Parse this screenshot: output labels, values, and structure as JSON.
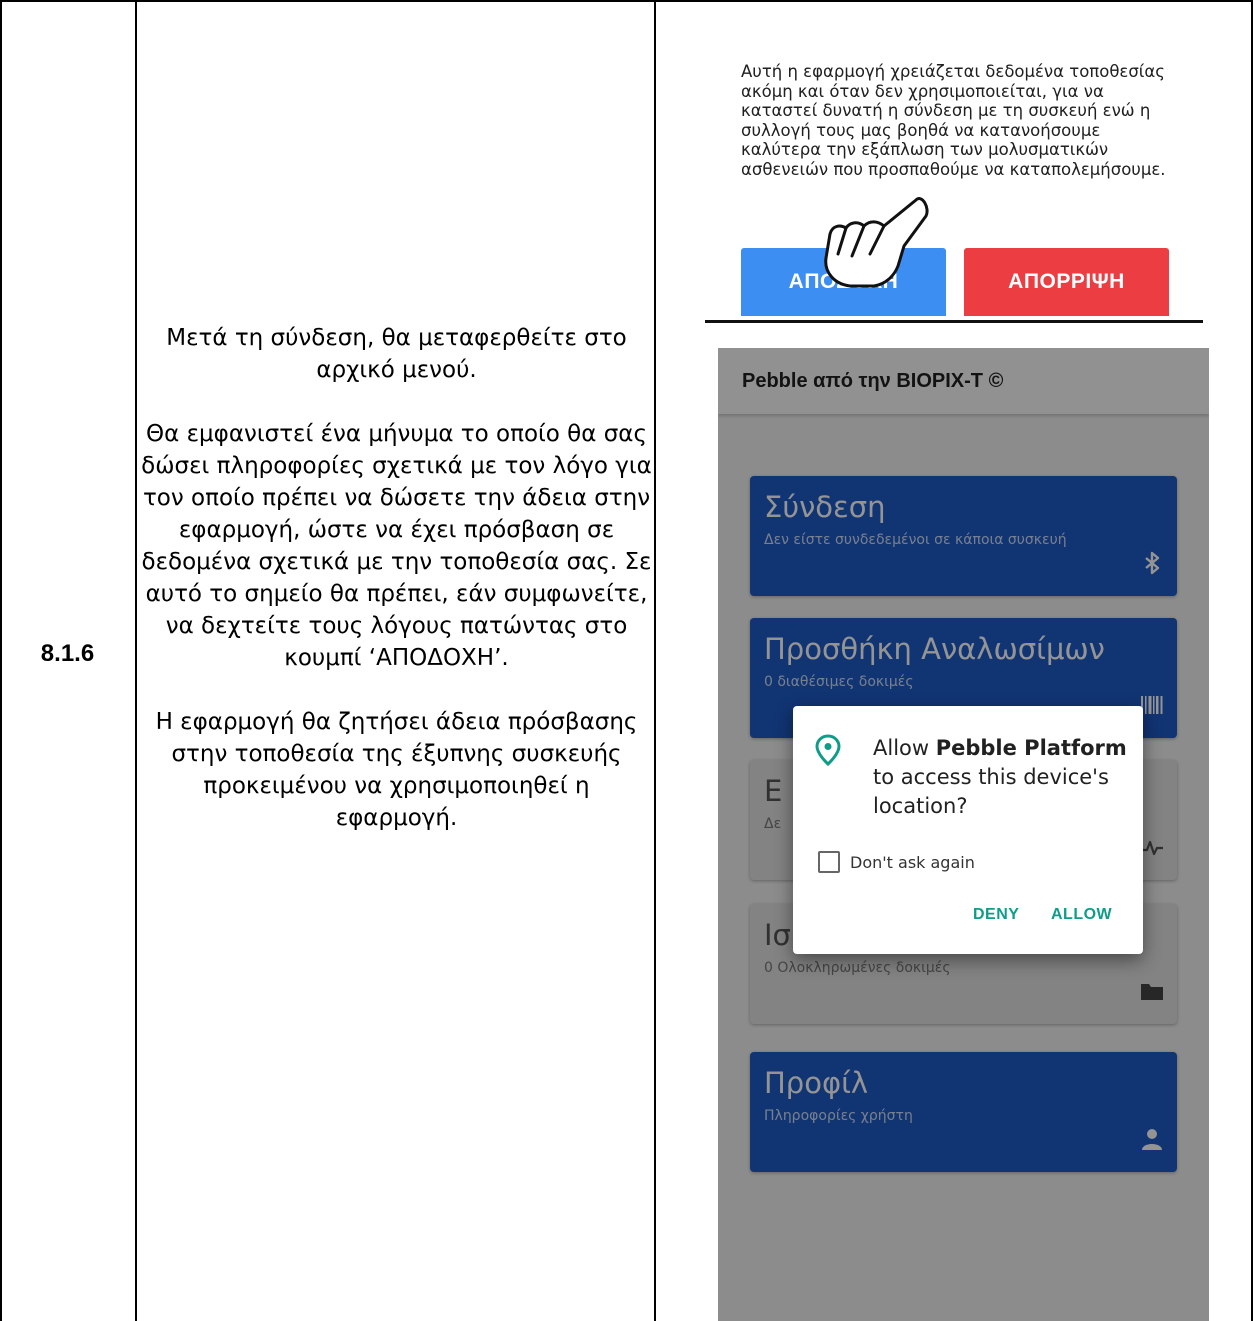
{
  "row": {
    "step_number": "8.1.6",
    "description": [
      "Μετά τη σύνδεση, θα μεταφερθείτε στο αρχικό μενού.",
      "Θα εμφανιστεί ένα μήνυμα το οποίο θα σας δώσει πληροφορίες σχετικά με τον λόγο για τον οποίο πρέπει να δώσετε την άδεια στην εφαρμογή, ώστε να έχει πρόσβαση σε δεδομένα σχετικά με την τοποθεσία σας. Σε αυτό το σημείο θα πρέπει, εάν συμφωνείτε, να δεχτείτε τους λόγους πατώντας στο κουμπί ‘ΑΠΟΔΟΧΗ’.",
      "Η εφαρμογή θα ζητήσει άδεια πρόσβασης στην τοποθεσία της έξυπνης συσκευής προκειμένου να χρησιμοποιηθεί η εφαρμογή."
    ]
  },
  "consent_screen": {
    "message": "Αυτή η εφαρμογή χρειάζεται δεδομένα τοποθεσίας ακόμη και όταν δεν χρησιμοποιείται, για να καταστεί δυνατή η σύνδεση με τη συσκευή ενώ η συλλογή τους μας βοηθά να κατανοήσουμε καλύτερα την εξάπλωση των μολυσματικών ασθενειών που προσπαθούμε να καταπολεμήσουμε.",
    "accept_label": "ΑΠΟΔΟΧΗ",
    "reject_label": "ΑΠΟΡΡΙΨΗ",
    "accept_color": "#3d8ef2",
    "reject_color": "#ec3d42"
  },
  "app": {
    "title": "Pebble από την BIOPIX-T ©",
    "cards": [
      {
        "title": "Σύνδεση",
        "subtitle": "Δεν είστε συνδεδεμένοι σε κάποια συσκευή",
        "icon": "bluetooth-icon"
      },
      {
        "title": "Προσθήκη Αναλωσίμων",
        "subtitle": "0 διαθέσιμες δοκιμές",
        "icon": "barcode-icon"
      },
      {
        "title": "Ε",
        "subtitle": "Δε",
        "icon": "chart-icon"
      },
      {
        "title": "Ισ",
        "subtitle": "0 Ολοκληρωμένες δοκιμές",
        "icon": "folder-icon"
      },
      {
        "title": "Προφίλ",
        "subtitle": "Πληροφορίες χρήστη",
        "icon": "person-icon"
      }
    ],
    "primary_color": "#1e5bc6"
  },
  "permission_dialog": {
    "msg_part1": "Allow ",
    "app_name": "Pebble Platform",
    "msg_part2": " to access this device's location?",
    "checkbox_label": "Don't ask again",
    "deny_label": "DENY",
    "allow_label": "ALLOW",
    "accent_color": "#0f9d8a"
  }
}
